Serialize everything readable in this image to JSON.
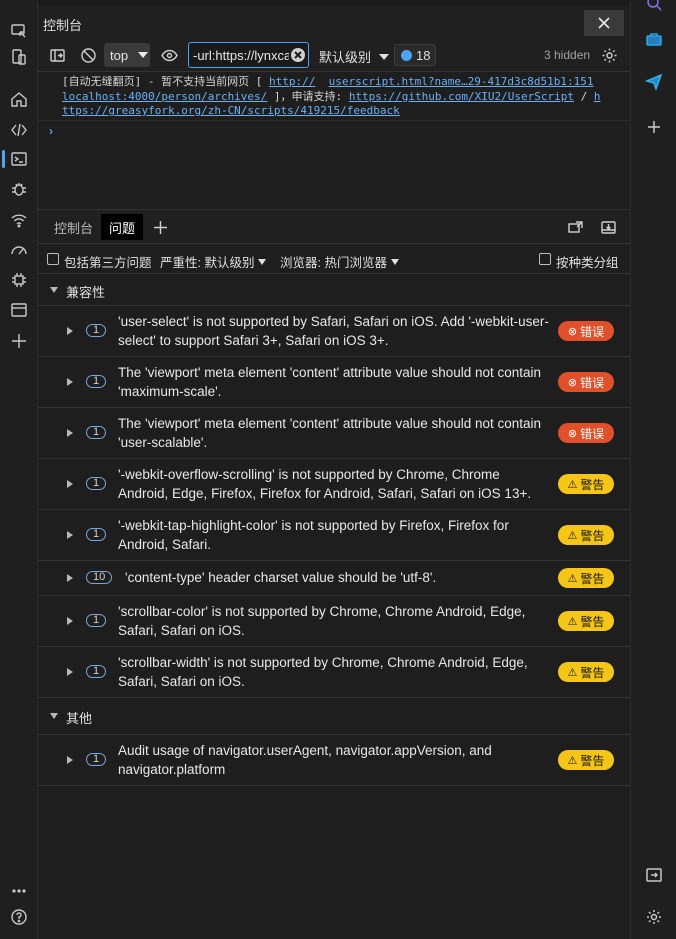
{
  "window": {
    "title": "控制台"
  },
  "toolbar": {
    "context": "top",
    "filter_value": "-url:https://lynxcat",
    "level": "默认级别",
    "issues_count": "18",
    "hidden": "3 hidden"
  },
  "console": {
    "log_text_1": "[自动无缝翻页] - 暂不支持当前网页 [ ",
    "log_link_1": "http://",
    "log_link_2": "userscript.html?name…29-417d3c8d51b1:151",
    "log_link_3": "localhost:4000/person/archives/",
    "log_text_2": " ]，申请支持: ",
    "log_link_4": "https://github.com/XIU2/UserScript",
    "log_text_3": " / ",
    "log_link_5": "h",
    "log_link_6": "ttps://greasyfork.org/zh-CN/scripts/419215/feedback",
    "prompt": "›"
  },
  "drawer": {
    "tabs": [
      "控制台",
      "问题"
    ],
    "add_label": "+"
  },
  "filters": {
    "third_party": "包括第三方问题",
    "severity": "严重性: 默认级别",
    "browser": "浏览器:  热门浏览器",
    "group_by_kind": "按种类分组"
  },
  "groups": [
    {
      "title": "兼容性",
      "issues": [
        {
          "count": "1",
          "message": "'user-select' is not supported by Safari, Safari on iOS. Add '-webkit-user-select' to support Safari 3+, Safari on iOS 3+.",
          "severity": "error",
          "label": "错误"
        },
        {
          "count": "1",
          "message": "The 'viewport' meta element 'content' attribute value should not contain 'maximum-scale'.",
          "severity": "error",
          "label": "错误"
        },
        {
          "count": "1",
          "message": "The 'viewport' meta element 'content' attribute value should not contain 'user-scalable'.",
          "severity": "error",
          "label": "错误"
        },
        {
          "count": "1",
          "message": "'-webkit-overflow-scrolling' is not supported by Chrome, Chrome Android, Edge, Firefox, Firefox for Android, Safari, Safari on iOS 13+.",
          "severity": "warning",
          "label": "警告"
        },
        {
          "count": "1",
          "message": "'-webkit-tap-highlight-color' is not supported by Firefox, Firefox for Android, Safari.",
          "severity": "warning",
          "label": "警告"
        },
        {
          "count": "10",
          "message": "'content-type' header charset value should be 'utf-8'.",
          "severity": "warning",
          "label": "警告"
        },
        {
          "count": "1",
          "message": "'scrollbar-color' is not supported by Chrome, Chrome Android, Edge, Safari, Safari on iOS.",
          "severity": "warning",
          "label": "警告"
        },
        {
          "count": "1",
          "message": "'scrollbar-width' is not supported by Chrome, Chrome Android, Edge, Safari, Safari on iOS.",
          "severity": "warning",
          "label": "警告"
        }
      ]
    },
    {
      "title": "其他",
      "issues": [
        {
          "count": "1",
          "message": "Audit usage of navigator.userAgent, navigator.appVersion, and navigator.platform",
          "severity": "warning",
          "label": "警告"
        }
      ]
    }
  ],
  "colors": {
    "accent": "#4fa3f7",
    "error": "#e0502a",
    "warning": "#f5c518"
  }
}
